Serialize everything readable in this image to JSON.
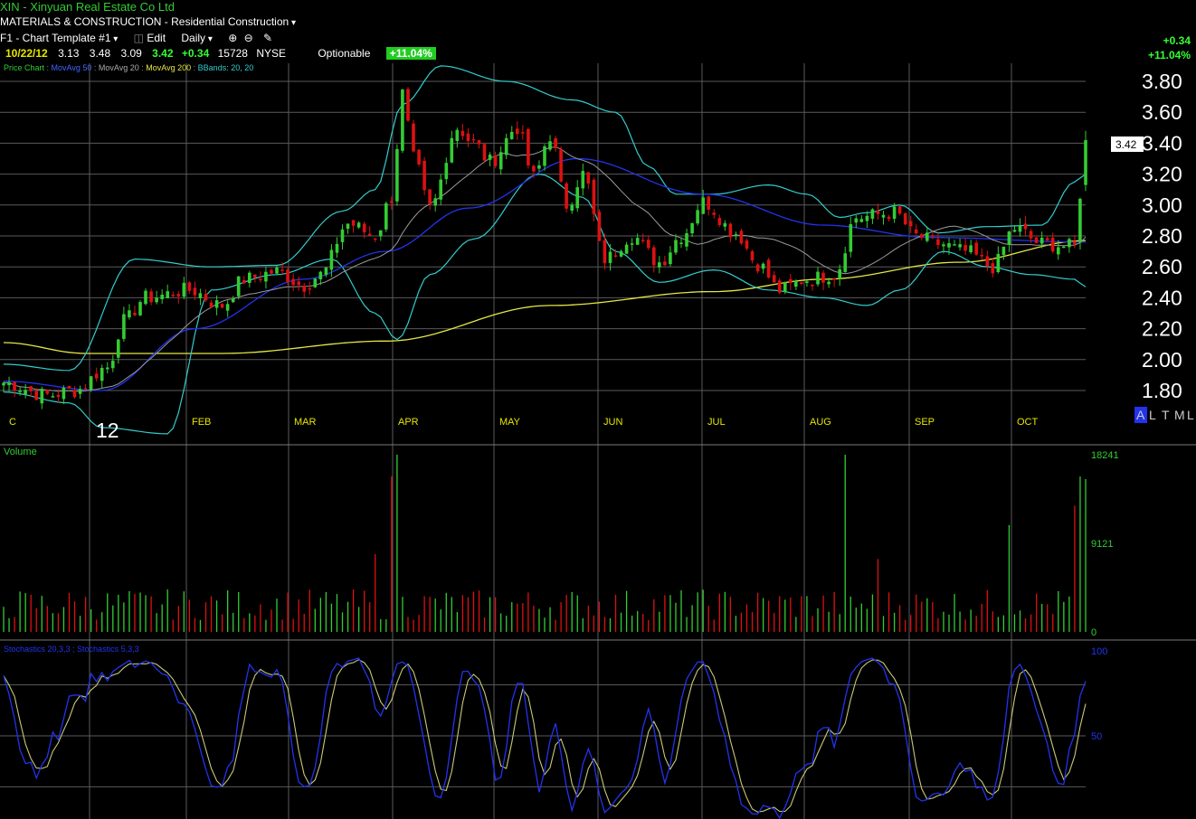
{
  "header": {
    "title": "XIN - Xinyuan Real Estate Co Ltd",
    "sector": "MATERIALS & CONSTRUCTION - Residential Construction",
    "template": "F1 - Chart Template #1",
    "edit": "Edit",
    "period": "Daily",
    "quote": {
      "date": "10/22/12",
      "open": "3.13",
      "high": "3.48",
      "low": "3.09",
      "close": "3.42",
      "change": "+0.34",
      "volume": "15728",
      "exchange": "NYSE"
    },
    "optionable": "Optionable",
    "pct_badge": "+11.04%",
    "right_change": "+0.34",
    "right_pct": "+11.04%"
  },
  "legend": {
    "price": "Price Chart",
    "ma50": "MovAvg 50",
    "ma20": "MovAvg 20",
    "ma200": "MovAvg 200",
    "bb": "BBands: 20, 20"
  },
  "colors": {
    "up": "#33cc33",
    "down": "#dd1111",
    "ma50": "#2233ee",
    "ma20": "#9a9a9a",
    "ma200": "#e6e645",
    "bbands": "#33cccc",
    "grid": "#5a5a5a",
    "stoch_fast": "#2233ee",
    "stoch_slow": "#c8c87a"
  },
  "price_tag": "3.42",
  "year_label": "12",
  "corner_labels": [
    "A",
    "L",
    "T",
    "M",
    "L"
  ],
  "chart_data": [
    {
      "type": "candlestick",
      "title": "Price Chart",
      "yticks": [
        "3.80",
        "3.60",
        "3.40",
        "3.20",
        "3.00",
        "2.80",
        "2.60",
        "2.40",
        "2.20",
        "2.00",
        "1.80"
      ],
      "ylim": [
        1.7,
        3.95
      ],
      "months": [
        "C",
        "FEB",
        "MAR",
        "APR",
        "MAY",
        "JUN",
        "JUL",
        "AUG",
        "SEP",
        "OCT"
      ],
      "grid": true,
      "anchors": {
        "price": [
          [
            0,
            1.85
          ],
          [
            8,
            1.77
          ],
          [
            13,
            1.8
          ],
          [
            19,
            1.95
          ],
          [
            22,
            2.25
          ],
          [
            26,
            2.4
          ],
          [
            34,
            2.45
          ],
          [
            40,
            2.35
          ],
          [
            44,
            2.52
          ],
          [
            50,
            2.57
          ],
          [
            55,
            2.48
          ],
          [
            58,
            2.55
          ],
          [
            63,
            2.88
          ],
          [
            68,
            2.8
          ],
          [
            71,
            3.05
          ],
          [
            73,
            3.72
          ],
          [
            75,
            3.3
          ],
          [
            78,
            2.98
          ],
          [
            83,
            3.5
          ],
          [
            86,
            3.4
          ],
          [
            89,
            3.28
          ],
          [
            94,
            3.5
          ],
          [
            97,
            3.18
          ],
          [
            100,
            3.45
          ],
          [
            103,
            3.0
          ],
          [
            106,
            3.2
          ],
          [
            110,
            2.65
          ],
          [
            115,
            2.8
          ],
          [
            120,
            2.63
          ],
          [
            124,
            2.8
          ],
          [
            128,
            3.02
          ],
          [
            134,
            2.82
          ],
          [
            138,
            2.62
          ],
          [
            142,
            2.45
          ],
          [
            147,
            2.52
          ],
          [
            152,
            2.55
          ],
          [
            156,
            2.92
          ],
          [
            163,
            2.95
          ],
          [
            167,
            2.8
          ],
          [
            171,
            2.75
          ],
          [
            176,
            2.7
          ],
          [
            181,
            2.6
          ],
          [
            185,
            2.85
          ],
          [
            190,
            2.75
          ],
          [
            196,
            2.73
          ],
          [
            198,
            3.42
          ]
        ],
        "ma200": [
          [
            0,
            2.11
          ],
          [
            15,
            2.04
          ],
          [
            40,
            2.04
          ],
          [
            70,
            2.12
          ],
          [
            100,
            2.35
          ],
          [
            130,
            2.44
          ],
          [
            150,
            2.52
          ],
          [
            175,
            2.63
          ],
          [
            198,
            2.77
          ]
        ],
        "ma50": [
          [
            0,
            1.86
          ],
          [
            18,
            1.8
          ],
          [
            35,
            2.2
          ],
          [
            55,
            2.52
          ],
          [
            70,
            2.7
          ],
          [
            85,
            2.98
          ],
          [
            105,
            3.3
          ],
          [
            128,
            3.07
          ],
          [
            150,
            2.87
          ],
          [
            170,
            2.79
          ],
          [
            198,
            2.76
          ]
        ],
        "bbu": [
          [
            0,
            1.97
          ],
          [
            12,
            1.93
          ],
          [
            24,
            2.65
          ],
          [
            38,
            2.6
          ],
          [
            50,
            2.61
          ],
          [
            62,
            2.96
          ],
          [
            68,
            3.1
          ],
          [
            73,
            3.65
          ],
          [
            80,
            3.9
          ],
          [
            92,
            3.8
          ],
          [
            104,
            3.68
          ],
          [
            112,
            3.6
          ],
          [
            118,
            3.25
          ],
          [
            123,
            3.07
          ],
          [
            130,
            3.07
          ],
          [
            140,
            3.13
          ],
          [
            147,
            3.07
          ],
          [
            153,
            2.92
          ],
          [
            158,
            2.95
          ],
          [
            164,
            3.0
          ],
          [
            171,
            2.82
          ],
          [
            180,
            2.86
          ],
          [
            190,
            2.87
          ],
          [
            196,
            3.15
          ],
          [
            198,
            3.2
          ]
        ],
        "bbl": [
          [
            0,
            1.79
          ],
          [
            12,
            1.72
          ],
          [
            18,
            1.56
          ],
          [
            30,
            1.52
          ],
          [
            38,
            2.45
          ],
          [
            50,
            2.55
          ],
          [
            60,
            2.65
          ],
          [
            68,
            2.3
          ],
          [
            72,
            2.13
          ],
          [
            78,
            2.55
          ],
          [
            86,
            2.78
          ],
          [
            98,
            3.2
          ],
          [
            106,
            3.05
          ],
          [
            112,
            2.7
          ],
          [
            120,
            2.5
          ],
          [
            130,
            2.58
          ],
          [
            140,
            2.45
          ],
          [
            150,
            2.4
          ],
          [
            158,
            2.35
          ],
          [
            164,
            2.45
          ],
          [
            172,
            2.7
          ],
          [
            180,
            2.6
          ],
          [
            188,
            2.55
          ],
          [
            196,
            2.52
          ],
          [
            198,
            2.47
          ]
        ]
      }
    },
    {
      "type": "bar",
      "title": "Volume",
      "yticks": [
        "18241",
        "9121",
        "0"
      ],
      "ylim": [
        0,
        18241
      ],
      "spikes": [
        [
          71,
          16000
        ],
        [
          72,
          18241
        ],
        [
          68,
          8000
        ],
        [
          154,
          18241
        ],
        [
          160,
          7500
        ],
        [
          184,
          11000
        ],
        [
          196,
          13000
        ],
        [
          197,
          16000
        ],
        [
          198,
          15728
        ]
      ]
    },
    {
      "type": "line",
      "title": "Stochastics 20,3,3 ; Stochastics 5,3,3",
      "yticks": [
        "100",
        "50"
      ],
      "ylim": [
        0,
        100
      ]
    }
  ]
}
